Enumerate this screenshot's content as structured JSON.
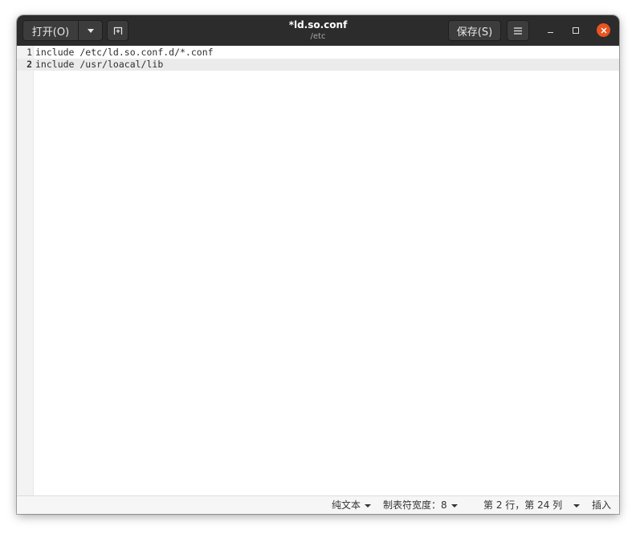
{
  "window": {
    "title": "*ld.so.conf",
    "subtitle": "/etc"
  },
  "header": {
    "open_label": "打开(O)",
    "open_menu_icon": "chevron-down-icon",
    "new_tab_icon": "new-tab-icon",
    "save_label": "保存(S)",
    "menu_icon": "hamburger-menu-icon",
    "minimize_icon": "minimize-icon",
    "maximize_icon": "maximize-icon",
    "close_icon": "close-icon",
    "close_color": "#e95420"
  },
  "editor": {
    "lines": [
      {
        "number": "1",
        "text": "include /etc/ld.so.conf.d/*.conf"
      },
      {
        "number": "2",
        "text": "include /usr/loacal/lib"
      }
    ],
    "current_line": 2
  },
  "statusbar": {
    "language": "纯文本",
    "tab_width": "制表符宽度：8",
    "cursor_position": "第 2 行，第 24 列",
    "insert_mode": "插入"
  }
}
